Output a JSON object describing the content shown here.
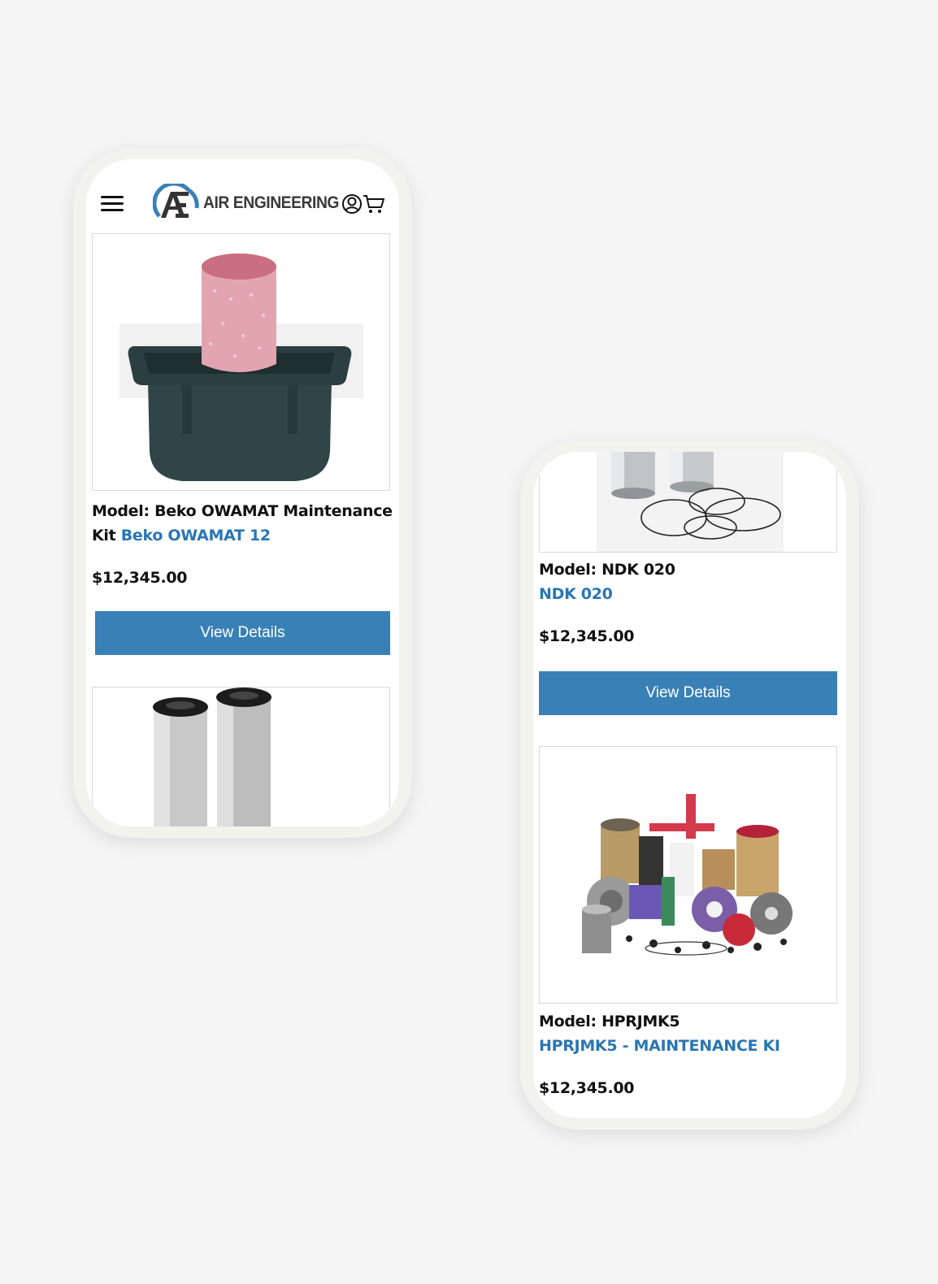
{
  "brand": {
    "name": "AIR ENGINEERING",
    "monogram": "AE"
  },
  "left_phone": {
    "product": {
      "model_label": "Model: Beko OWAMAT Maintenance Kit",
      "link_text": "Beko OWAMAT 12",
      "price": "$12,345.00",
      "button_label": "View Details"
    }
  },
  "right_phone": {
    "products": [
      {
        "model_label": "Model: NDK 020",
        "link_text": "NDK 020",
        "price": "$12,345.00",
        "button_label": "View Details"
      },
      {
        "model_label": "Model: HPRJMK5",
        "link_text": "HPRJMK5 - MAINTENANCE KI",
        "price": "$12,345.00"
      }
    ]
  },
  "colors": {
    "accent": "#3980b6",
    "link": "#2a76b4",
    "background": "#f5f5f5"
  }
}
